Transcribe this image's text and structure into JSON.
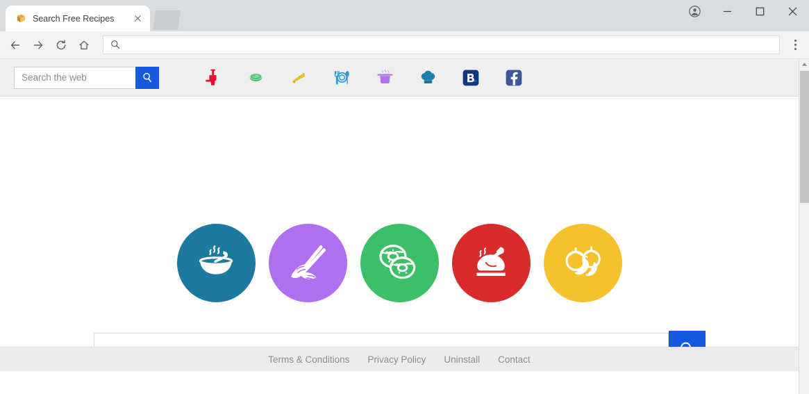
{
  "browser": {
    "tab": {
      "title": "Search Free Recipes",
      "favicon_icon": "gold-box-favicon",
      "close_icon": "close-icon"
    },
    "new_tab_icon": "new-tab-icon",
    "window_controls": {
      "profile_icon": "profile-avatar-icon",
      "minimize_icon": "minimize-icon",
      "maximize_icon": "maximize-icon",
      "close_icon": "window-close-icon"
    },
    "nav": {
      "back_icon": "back-arrow-icon",
      "forward_icon": "forward-arrow-icon",
      "reload_icon": "reload-icon",
      "home_icon": "home-icon",
      "menu_icon": "three-dot-menu-icon"
    },
    "omnibox": {
      "value": "",
      "placeholder": "",
      "icon": "search-icon"
    }
  },
  "ext_toolbar": {
    "search": {
      "placeholder": "Search the web",
      "value": "",
      "button_icon": "search-icon",
      "button_color": "#1557df"
    },
    "icons": [
      {
        "name": "meat-grinder-icon",
        "label": "Meat Grinder",
        "color": "#e8112d"
      },
      {
        "name": "green-bowl-icon",
        "label": "Bowl",
        "color": "#4cc97a"
      },
      {
        "name": "cheese-wedge-icon",
        "label": "Cheese",
        "color": "#f2c230"
      },
      {
        "name": "plate-cutlery-icon",
        "label": "Plate & Cutlery",
        "color": "#2e9bd6"
      },
      {
        "name": "cooking-pot-icon",
        "label": "Cooking Pot",
        "color": "#b36ef0"
      },
      {
        "name": "chef-hat-icon",
        "label": "Chef Hat",
        "color": "#1f7fa8"
      },
      {
        "name": "booking-logo-icon",
        "label": "Booking.com",
        "color": "#10377f"
      },
      {
        "name": "facebook-logo-icon",
        "label": "Facebook",
        "color": "#3b5998"
      }
    ]
  },
  "main": {
    "categories": [
      {
        "name": "soup-bowl-category",
        "label": "Soups",
        "icon": "soup-bowl-icon",
        "color": "#1d7a9e"
      },
      {
        "name": "sushi-chopsticks-category",
        "label": "Sushi",
        "icon": "sushi-chopsticks-icon",
        "color": "#b06ef0"
      },
      {
        "name": "donuts-category",
        "label": "Desserts",
        "icon": "donuts-icon",
        "color": "#3cc067"
      },
      {
        "name": "roast-chicken-category",
        "label": "Meat",
        "icon": "roast-chicken-icon",
        "color": "#d92b2b"
      },
      {
        "name": "vegetables-category",
        "label": "Vegetables",
        "icon": "vegetables-icon",
        "color": "#f5c22e"
      }
    ],
    "search": {
      "value": "",
      "placeholder": "",
      "button_icon": "search-icon",
      "button_color": "#1557df"
    }
  },
  "footer": {
    "links": [
      {
        "name": "terms-conditions-link",
        "label": "Terms & Conditions"
      },
      {
        "name": "privacy-policy-link",
        "label": "Privacy Policy"
      },
      {
        "name": "uninstall-link",
        "label": "Uninstall"
      },
      {
        "name": "contact-link",
        "label": "Contact"
      }
    ]
  },
  "scrollbar": {
    "up_arrow_icon": "scroll-up-arrow-icon",
    "thumb": "scroll-thumb"
  }
}
